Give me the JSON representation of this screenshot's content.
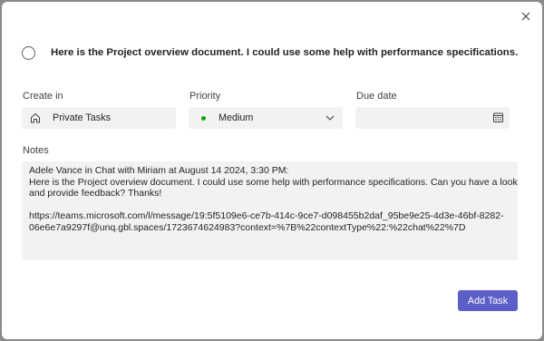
{
  "task": {
    "title": "Here is the Project overview document. I could use some help with performance specifications. Can you h..."
  },
  "fields": {
    "create_in": {
      "label": "Create in",
      "value": "Private Tasks",
      "icon": "home-icon"
    },
    "priority": {
      "label": "Priority",
      "value": "Medium",
      "dot_color": "#13a10e",
      "icon": "chevron-down-icon"
    },
    "due_date": {
      "label": "Due date",
      "value": "",
      "icon": "calendar-icon"
    }
  },
  "notes": {
    "label": "Notes",
    "lines": [
      "Adele Vance in Chat with Miriam at August 14 2024, 3:30 PM:",
      "Here is the Project overview document. I could use some help with performance specifications. Can you have a look",
      "and provide feedback? Thanks!",
      "",
      "https://teams.microsoft.com/l/message/19:5f5109e6-ce7b-414c-9ce7-d098455b2daf_95be9e25-4d3e-46bf-8282-",
      "06e6e7a9297f@unq.gbl.spaces/1723674624983?context=%7B%22contextType%22:%22chat%22%7D"
    ]
  },
  "actions": {
    "add_task_label": "Add Task",
    "close_icon": "close-icon"
  },
  "colors": {
    "accent": "#5b5fc7",
    "field_bg": "#f2f2f2",
    "backdrop": "#8a8a8a"
  }
}
